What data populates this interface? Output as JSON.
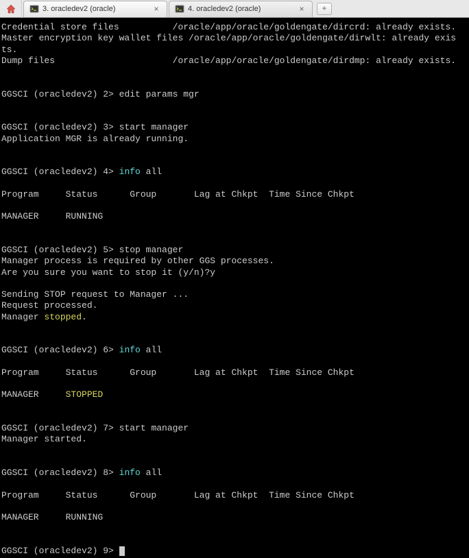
{
  "tabs": [
    {
      "label": "3. oracledev2 (oracle)",
      "active": true
    },
    {
      "label": "4. oracledev2 (oracle)",
      "active": false
    }
  ],
  "term": {
    "l1": "Credential store files          /oracle/app/oracle/goldengate/dircrd: already exists.",
    "l2": "Master encryption key wallet files /oracle/app/oracle/goldengate/dirwlt: already exis",
    "l3": "ts.",
    "l4": "Dump files                      /oracle/app/oracle/goldengate/dirdmp: already exists.",
    "p2": "GGSCI (oracledev2) 2> ",
    "p2cmd": "edit params mgr",
    "p3": "GGSCI (oracledev2) 3> ",
    "p3cmd": "start manager",
    "p3r": "Application MGR is already running.",
    "p4": "GGSCI (oracledev2) 4> ",
    "info": "info ",
    "all": "all",
    "hdr": "Program     Status      Group       Lag at Chkpt  Time Since Chkpt",
    "row_run": "MANAGER     RUNNING",
    "p5": "GGSCI (oracledev2) 5> ",
    "p5cmd": "stop manager",
    "p5r1": "Manager process is required by other GGS processes.",
    "p5r2": "Are you sure you want to stop it (y/n)?y",
    "p5r3": "Sending STOP request to Manager ...",
    "p5r4": "Request processed.",
    "p5r5a": "Manager ",
    "stopped_word": "stopped",
    "dot": ".",
    "p6": "GGSCI (oracledev2) 6> ",
    "row_stop_a": "MANAGER     ",
    "stopped_status": "STOPPED",
    "p7": "GGSCI (oracledev2) 7> ",
    "p7cmd": "start manager",
    "p7r": "Manager started.",
    "p8": "GGSCI (oracledev2) 8> ",
    "p9": "GGSCI (oracledev2) 9> "
  }
}
